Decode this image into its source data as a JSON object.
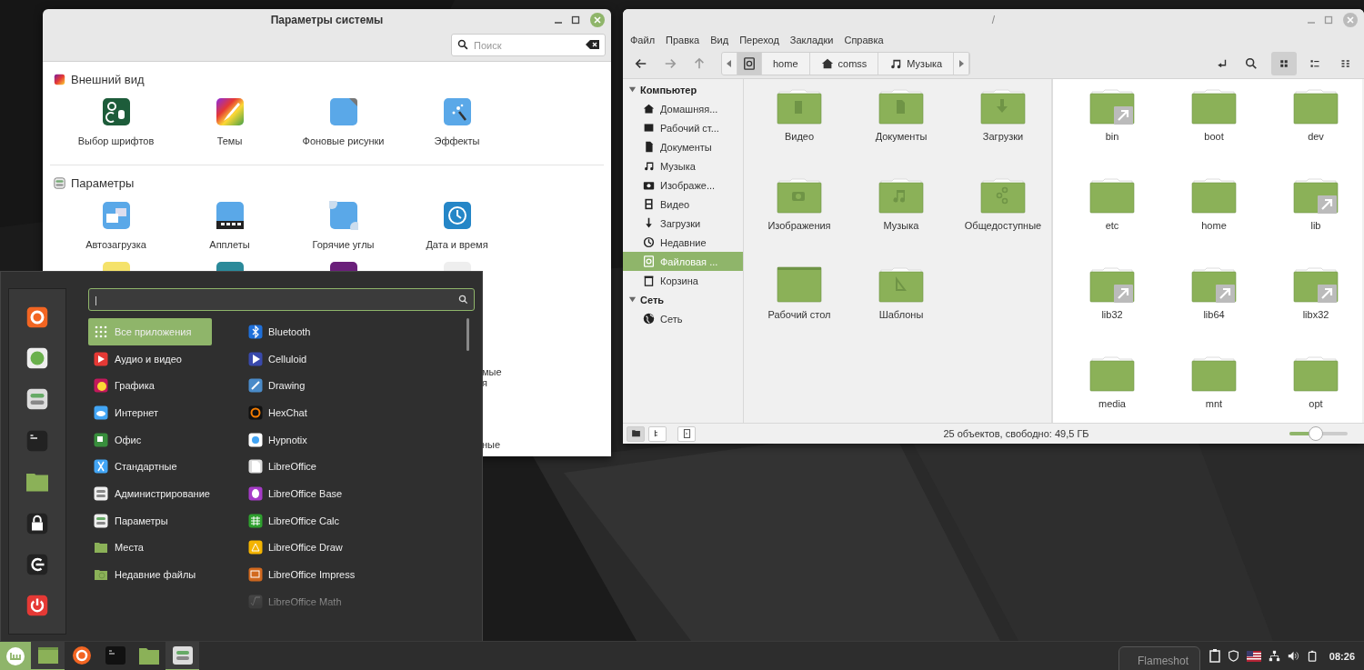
{
  "settings_window": {
    "title": "Параметры системы",
    "search": {
      "placeholder": "Поиск"
    },
    "sections": [
      {
        "title": "Внешний вид",
        "items": [
          {
            "label": "Выбор шрифтов"
          },
          {
            "label": "Темы"
          },
          {
            "label": "Фоновые рисунки"
          },
          {
            "label": "Эффекты"
          }
        ]
      },
      {
        "title": "Параметры",
        "items": [
          {
            "label": "Автозагрузка"
          },
          {
            "label": "Апплеты"
          },
          {
            "label": "Горячие углы"
          },
          {
            "label": "Дата и время"
          }
        ]
      }
    ],
    "partial_texts": [
      "мые",
      "я",
      "ные"
    ]
  },
  "file_manager": {
    "title": "/",
    "menu": [
      "Файл",
      "Правка",
      "Вид",
      "Переход",
      "Закладки",
      "Справка"
    ],
    "path": [
      {
        "selected": true
      },
      {
        "label": "home",
        "selected": false
      },
      {
        "label": "comss",
        "selected": false
      },
      {
        "label": "Музыка",
        "selected": false
      }
    ],
    "views": [
      {
        "selected": true
      },
      {
        "selected": false
      },
      {
        "selected": false
      }
    ],
    "sidebar": [
      {
        "title": "Компьютер",
        "expanded": true,
        "items": [
          {
            "label": "Домашняя...",
            "selected": false
          },
          {
            "label": "Рабочий ст...",
            "selected": false
          },
          {
            "label": "Документы",
            "selected": false
          },
          {
            "label": "Музыка",
            "selected": false
          },
          {
            "label": "Изображе...",
            "selected": false
          },
          {
            "label": "Видео",
            "selected": false
          },
          {
            "label": "Загрузки",
            "selected": false
          },
          {
            "label": "Недавние",
            "selected": false
          },
          {
            "label": "Файловая ...",
            "selected": true
          },
          {
            "label": "Корзина",
            "selected": false
          }
        ]
      },
      {
        "title": "Сеть",
        "expanded": true,
        "items": [
          {
            "label": "Сеть",
            "selected": false
          }
        ]
      }
    ],
    "left_pane": [
      {
        "name": "Видео"
      },
      {
        "name": "Документы"
      },
      {
        "name": "Загрузки"
      },
      {
        "name": "Изображения"
      },
      {
        "name": "Музыка"
      },
      {
        "name": "Общедоступные"
      },
      {
        "name": "Рабочий стол"
      },
      {
        "name": "Шаблоны"
      }
    ],
    "right_pane": [
      {
        "name": "bin",
        "link": true
      },
      {
        "name": "boot",
        "link": false
      },
      {
        "name": "dev",
        "link": false
      },
      {
        "name": "etc",
        "link": false
      },
      {
        "name": "home",
        "link": false
      },
      {
        "name": "lib",
        "link": true
      },
      {
        "name": "lib32",
        "link": true
      },
      {
        "name": "lib64",
        "link": true
      },
      {
        "name": "libx32",
        "link": true
      },
      {
        "name": "media",
        "link": false
      },
      {
        "name": "mnt",
        "link": false
      },
      {
        "name": "opt",
        "link": false
      }
    ],
    "status_buttons": [
      {
        "selected": true
      },
      {
        "selected": false
      },
      {
        "selected": false
      }
    ],
    "status": "25 объектов, свободно: 49,5 ГБ",
    "zoom": {
      "level": 0.45
    }
  },
  "start_menu": {
    "search": {
      "value": "|"
    },
    "categories": [
      {
        "label": "Все приложения",
        "selected": true
      },
      {
        "label": "Аудио и видео",
        "selected": false
      },
      {
        "label": "Графика",
        "selected": false
      },
      {
        "label": "Интернет",
        "selected": false
      },
      {
        "label": "Офис",
        "selected": false
      },
      {
        "label": "Стандартные",
        "selected": false
      },
      {
        "label": "Администрирование",
        "selected": false
      },
      {
        "label": "Параметры",
        "selected": false
      },
      {
        "label": "Места",
        "selected": false
      },
      {
        "label": "Недавние файлы",
        "selected": false
      }
    ],
    "apps": [
      "Bluetooth",
      "Celluloid",
      "Drawing",
      "HexChat",
      "Hypnotix",
      "LibreOffice",
      "LibreOffice Base",
      "LibreOffice Calc",
      "LibreOffice Draw",
      "LibreOffice Impress",
      "LibreOffice Math"
    ]
  },
  "taskbar": {
    "tooltip": "Flameshot",
    "clock": "08:26"
  }
}
